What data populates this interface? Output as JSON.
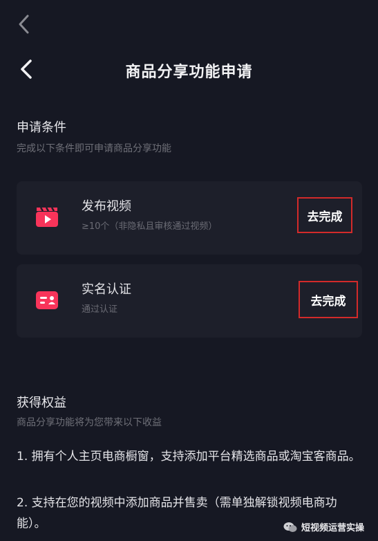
{
  "header": {
    "title": "商品分享功能申请"
  },
  "conditions": {
    "title": "申请条件",
    "subtitle": "完成以下条件即可申请商品分享功能",
    "items": [
      {
        "icon": "video-clapper-icon",
        "title": "发布视频",
        "subtitle": "≥10个（非隐私且审核通过视频）",
        "button": "去完成"
      },
      {
        "icon": "id-card-icon",
        "title": "实名认证",
        "subtitle": "通过认证",
        "button": "去完成"
      }
    ]
  },
  "benefits": {
    "title": "获得权益",
    "subtitle": "商品分享功能将为您带来以下收益",
    "items": [
      "1. 拥有个人主页电商橱窗，支持添加平台精选商品或淘宝客商品。",
      "2. 支持在您的视频中添加商品并售卖（需单独解锁视频电商功能）。"
    ]
  },
  "watermark": {
    "text": "短视频运营实操",
    "icon": "wechat-icon"
  },
  "colors": {
    "background": "#161823",
    "card": "#1d1f2a",
    "accent": "#f8345a",
    "highlight_border": "#d32a2a"
  }
}
